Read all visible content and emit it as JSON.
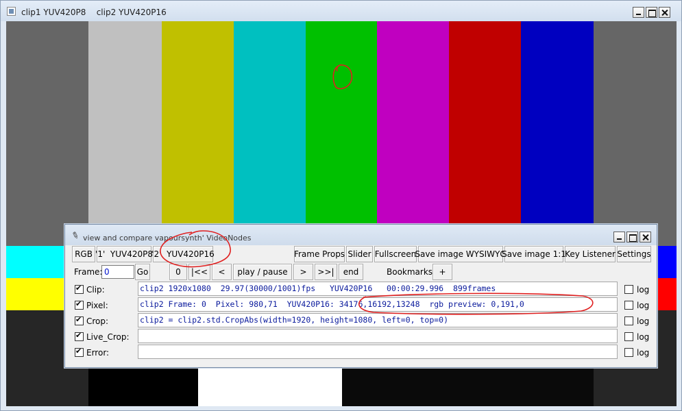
{
  "main_window": {
    "title": "clip1 YUV420P8    clip2 YUV420P16"
  },
  "video": {
    "bars_top": [
      "#666666",
      "#c0c0c0",
      "#c0c000",
      "#00c0c0",
      "#00c000",
      "#c000c0",
      "#c00000",
      "#0000c0",
      "#666666"
    ],
    "bars_mid_left": [
      "#00ffff",
      "#ffff00"
    ],
    "bars_mid_right": [
      "#0000ff",
      "#ff0000"
    ],
    "bottom_white": "#ffffff"
  },
  "tool_window": {
    "title": "view and compare vapoursynth' VideoNodes",
    "buttons": {
      "rgb": "RGB",
      "clip1": "'1'  YUV420P8",
      "clip2": "'2'  YUV420P16",
      "frame_props": "Frame Props",
      "slider": "Slider",
      "fullscreen": "Fullscreen",
      "save_wysiwyg": "Save image WYSIWYG",
      "save_1to1": "Save image 1:1",
      "key_listener": "Key Listener",
      "settings": "Settings",
      "go": "Go",
      "zero": "0",
      "first": "|<<",
      "prev": "<",
      "play_pause": "play / pause",
      "next": ">",
      "last": ">>|",
      "end": "end",
      "add_bookmark": "+"
    },
    "frame_label": "Frame:",
    "frame_value": "0",
    "bookmarks_label": "Bookmarks:",
    "rows": [
      {
        "label": "Clip:",
        "text": "clip2 1920x1080  29.97(30000/1001)fps   YUV420P16   00:00:29.996  899frames",
        "log": "log"
      },
      {
        "label": "Pixel:",
        "text": "clip2 Frame: 0  Pixel: 980,71  YUV420P16: 34176,16192,13248  rgb preview: 0,191,0",
        "log": "log"
      },
      {
        "label": "Crop:",
        "text": "clip2 = clip2.std.CropAbs(width=1920, height=1080, left=0, top=0)",
        "log": "log"
      },
      {
        "label": "Live_Crop:",
        "text": "",
        "log": "log"
      },
      {
        "label": "Error:",
        "text": "",
        "log": "log"
      }
    ]
  },
  "annotation_color": "#e02020"
}
